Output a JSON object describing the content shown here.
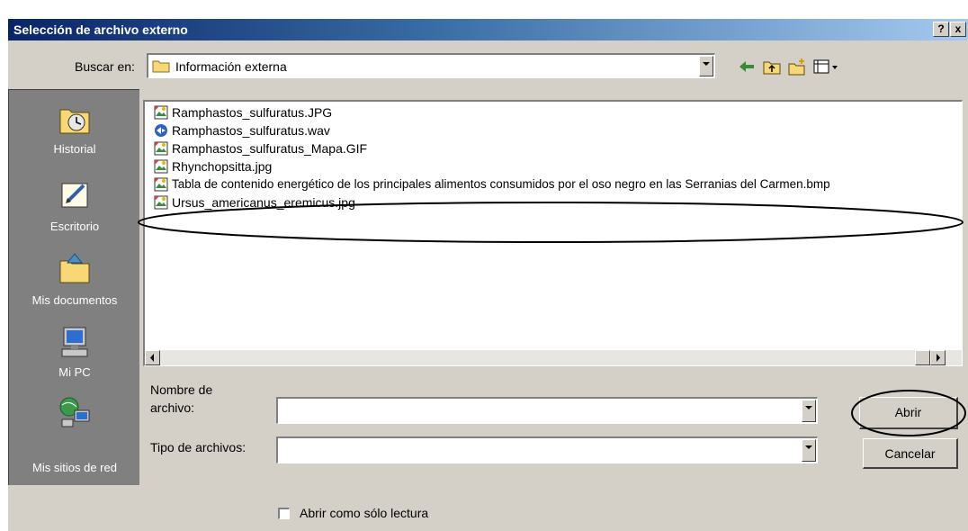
{
  "window": {
    "title": "Selección de archivo externo",
    "help_label": "?",
    "close_label": "x"
  },
  "lookin": {
    "label": "Buscar en:",
    "value": "Información externa"
  },
  "places": [
    {
      "label": "Historial",
      "icon": "history-icon"
    },
    {
      "label": "Escritorio",
      "icon": "desktop-icon"
    },
    {
      "label": "Mis documentos",
      "icon": "my-documents-icon"
    },
    {
      "label": "Mi PC",
      "icon": "my-computer-icon"
    },
    {
      "label": "Mis sitios de red",
      "icon": "network-places-icon"
    }
  ],
  "files": [
    {
      "name": "Ramphastos_sulfuratus.JPG",
      "icon": "image-file-icon"
    },
    {
      "name": "Ramphastos_sulfuratus.wav",
      "icon": "audio-file-icon"
    },
    {
      "name": "Ramphastos_sulfuratus_Mapa.GIF",
      "icon": "image-file-icon"
    },
    {
      "name": "Rhynchopsitta.jpg",
      "icon": "image-file-icon"
    },
    {
      "name": "Tabla de contenido energético de los principales alimentos consumidos por el oso negro en las Serranias del Carmen.bmp",
      "icon": "image-file-icon"
    },
    {
      "name": "Ursus_americanus_eremicus.jpg",
      "icon": "image-file-icon"
    }
  ],
  "form": {
    "filename_label_line1": "Nombre de",
    "filename_label_line2": "archivo:",
    "filename_value": "",
    "filetype_label": "Tipo de archivos:",
    "filetype_value": "",
    "readonly_label": "Abrir como sólo lectura",
    "readonly_checked": false
  },
  "buttons": {
    "open": "Abrir",
    "cancel": "Cancelar"
  },
  "colors": {
    "title_start": "#0a246a",
    "title_end": "#a6caf0",
    "dialog_bg": "#d4d0c8",
    "places_bg": "#808080"
  }
}
